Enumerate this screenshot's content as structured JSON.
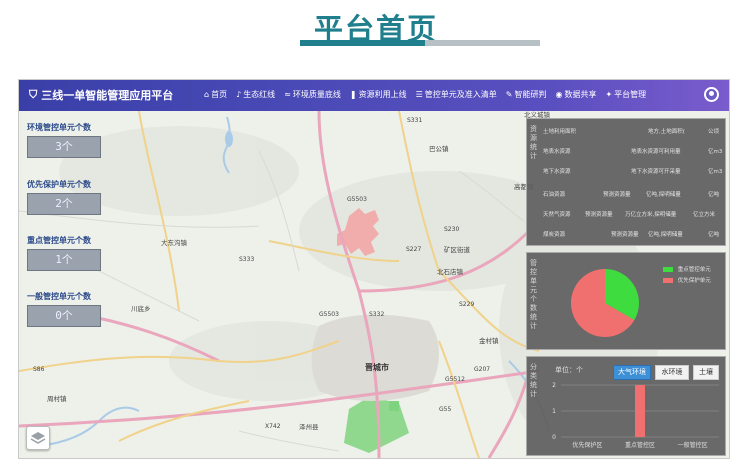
{
  "slide": {
    "title": "平台首页"
  },
  "app": {
    "name": "三线一单智能管理应用平台"
  },
  "nav": [
    {
      "icon": "home-icon",
      "glyph": "⌂",
      "label": "首页"
    },
    {
      "icon": "bell-icon",
      "glyph": "♪",
      "label": "生态红线"
    },
    {
      "icon": "wave-icon",
      "glyph": "≈",
      "label": "环境质量底线"
    },
    {
      "icon": "drop-icon",
      "glyph": "❚",
      "label": "资源利用上线"
    },
    {
      "icon": "list-icon",
      "glyph": "☰",
      "label": "管控单元及准入清单"
    },
    {
      "icon": "tool-icon",
      "glyph": "✎",
      "label": "智能研判"
    },
    {
      "icon": "globe-icon",
      "glyph": "◉",
      "label": "数据共享"
    },
    {
      "icon": "gear-icon",
      "glyph": "✦",
      "label": "平台管理"
    }
  ],
  "counters": [
    {
      "label": "环境管控单元个数",
      "value": "3个"
    },
    {
      "label": "优先保护单元个数",
      "value": "2个"
    },
    {
      "label": "重点管控单元个数",
      "value": "1个"
    },
    {
      "label": "一般管控单元个数",
      "value": "0个"
    }
  ],
  "resource_panel": {
    "title": "资源统计",
    "rows": [
      [
        "土地利用面积",
        "",
        "地方,土地面积(",
        "公顷"
      ],
      [
        "地表水资源",
        "",
        "地表水资源可利用量",
        "亿m3"
      ],
      [
        "地下水资源",
        "",
        "地下水资源可开采量",
        "亿m3"
      ],
      [
        "石油资源",
        "预测资源量",
        "亿吨,探明储量",
        "亿吨"
      ],
      [
        "天然气资源",
        "预测资源量",
        "万亿立方米,探明储量",
        "亿立方米"
      ],
      [
        "煤炭资源",
        "预测资源量",
        "亿吨,探明储量",
        "亿吨"
      ]
    ]
  },
  "unit_panel": {
    "title": "管控单元个数统计",
    "legend": [
      "重点管控单元",
      "优先保护单元"
    ],
    "colors": {
      "key": "#3fdc3f",
      "priority": "#f07070"
    }
  },
  "chart_panel": {
    "title": "分类统计",
    "unit": "单位：个",
    "tabs": [
      "大气环境",
      "水环境",
      "土壤"
    ],
    "active_tab": "大气环境",
    "chart_data": {
      "type": "bar",
      "categories": [
        "优先保护区",
        "重点管控区",
        "一般管控区"
      ],
      "values": [
        0,
        2,
        0
      ],
      "ylim": [
        0,
        2
      ],
      "yticks": [
        "0",
        "1",
        "2"
      ],
      "color": "#f07070"
    }
  },
  "map": {
    "city": "晋城市",
    "towns": [
      "巴公镇",
      "北石店镇",
      "大东沟镇",
      "川底乡",
      "周村镇",
      "泽州县",
      "金村镇",
      "矿区街道",
      "高都镇",
      "北义城镇"
    ],
    "roads": [
      "S86",
      "G5503",
      "S332",
      "S230",
      "G55",
      "S227",
      "S229",
      "G5512",
      "G207",
      "X742",
      "S331",
      "S333"
    ]
  }
}
